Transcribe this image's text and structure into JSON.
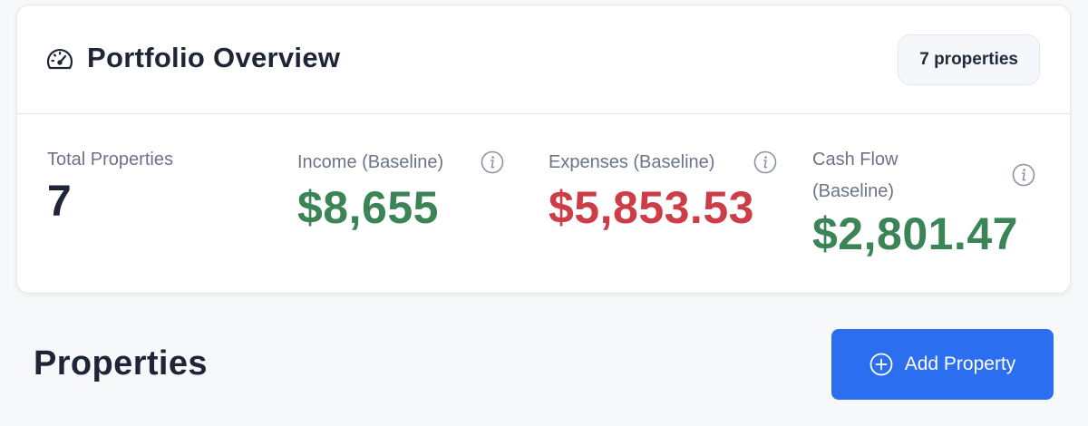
{
  "overview": {
    "title": "Portfolio Overview",
    "title_icon": "gauge-icon",
    "count_badge": "7 properties"
  },
  "stats": {
    "total": {
      "label": "Total Properties",
      "value": "7"
    },
    "income": {
      "label": "Income (Baseline)",
      "value": "$8,655",
      "info_icon": "info-icon",
      "color": "#3a8456"
    },
    "expenses": {
      "label": "Expenses (Baseline)",
      "value": "$5,853.53",
      "info_icon": "info-icon",
      "color": "#cc3d47"
    },
    "cash_flow": {
      "label_line1": "Cash Flow",
      "label_line2": "(Baseline)",
      "value": "$2,801.47",
      "info_icon": "info-icon",
      "color": "#3a8456"
    }
  },
  "properties_section": {
    "title": "Properties",
    "add_button": {
      "label": "Add Property",
      "icon": "plus-circle-icon",
      "color": "#2c6ef0"
    }
  }
}
